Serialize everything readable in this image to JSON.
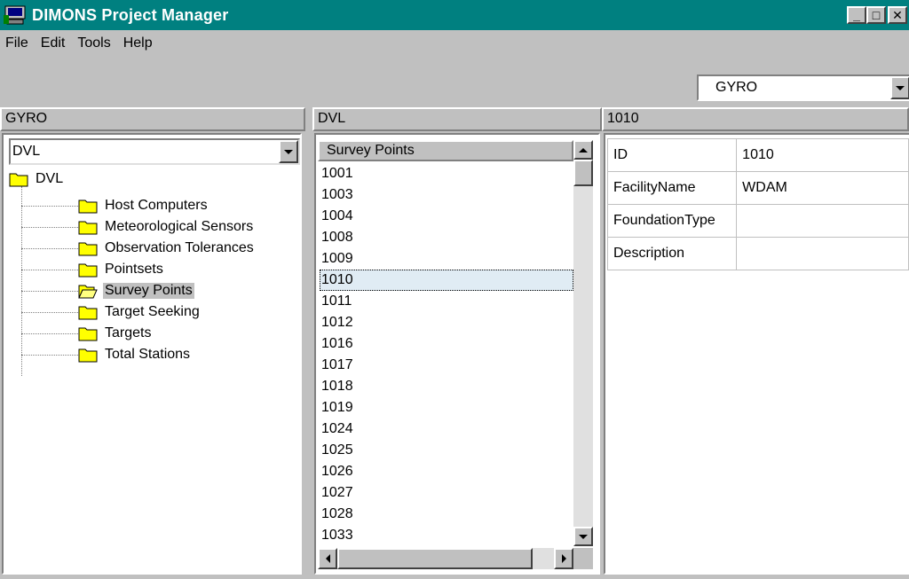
{
  "window": {
    "title": "DIMONS Project Manager",
    "minimize": "_",
    "maximize": "□",
    "close": "✕"
  },
  "menu": [
    "File",
    "Edit",
    "Tools",
    "Help"
  ],
  "top_selector": {
    "value": "GYRO"
  },
  "panes": {
    "left": {
      "header": "GYRO",
      "combo_value": "DVL"
    },
    "middle": {
      "header": "DVL",
      "column_header": "Survey Points"
    },
    "right": {
      "header": "1010"
    }
  },
  "tree": {
    "root": "DVL",
    "children": [
      "Host Computers",
      "Meteorological Sensors",
      "Observation Tolerances",
      "Pointsets",
      "Survey Points",
      "Target Seeking",
      "Targets",
      "Total Stations"
    ],
    "selected": "Survey Points"
  },
  "survey_points": [
    "1001",
    "1003",
    "1004",
    "1008",
    "1009",
    "1010",
    "1011",
    "1012",
    "1016",
    "1017",
    "1018",
    "1019",
    "1024",
    "1025",
    "1026",
    "1027",
    "1028",
    "1033"
  ],
  "selected_point": "1010",
  "properties": [
    {
      "key": "ID",
      "value": "1010"
    },
    {
      "key": "FacilityName",
      "value": "WDAM"
    },
    {
      "key": "FoundationType",
      "value": ""
    },
    {
      "key": "Description",
      "value": ""
    }
  ],
  "colors": {
    "titlebar": "#008080",
    "face": "#c0c0c0",
    "folder": "#ffff00"
  }
}
